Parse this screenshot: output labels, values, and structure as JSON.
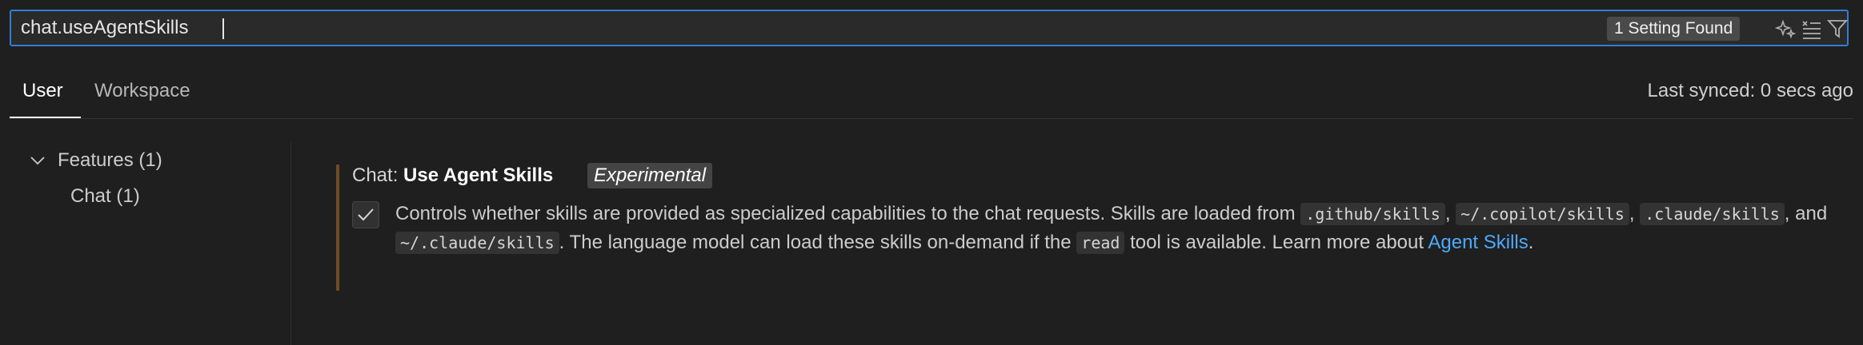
{
  "search": {
    "value": "chat.useAgentSkills",
    "result_count": "1 Setting Found",
    "icons": [
      "sparkle-icon",
      "clear-filter-icon",
      "filter-icon"
    ]
  },
  "tabs": [
    {
      "label": "User",
      "active": true
    },
    {
      "label": "Workspace",
      "active": false
    }
  ],
  "sync_status": "Last synced: 0 secs ago",
  "tree": [
    {
      "label": "Features (1)",
      "expanded": true
    },
    {
      "label": "Chat (1)"
    }
  ],
  "setting": {
    "category": "Chat: ",
    "name": "Use Agent Skills",
    "tag": "Experimental",
    "checked": true,
    "desc": {
      "t1": "Controls whether skills are provided as specialized capabilities to the chat requests. Skills are loaded from ",
      "c1": ".github/skills",
      "t2": ", ",
      "c2": "~/.copilot/skills",
      "t3": ", ",
      "c3": ".claude/skills",
      "t4": ", and ",
      "c4": "~/.claude/skills",
      "t5": ". The language model can load these skills on-demand if the ",
      "c5": "read",
      "t6": " tool is available. Learn more about ",
      "link": "Agent Skills",
      "t7": "."
    }
  },
  "colors": {
    "accent": "#2f7fd4",
    "link": "#4daafc",
    "modified_bar": "#6e4c23",
    "background": "#1f1f1f"
  }
}
